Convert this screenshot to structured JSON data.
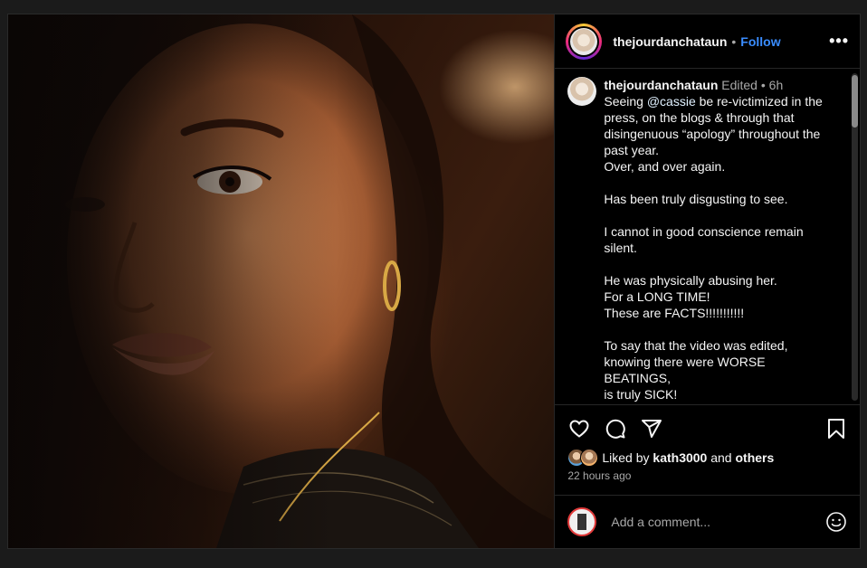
{
  "post": {
    "username": "thejourdanchataun",
    "follow_label": "Follow",
    "separator": "•",
    "more_label": "•••",
    "photo_alt": "portrait photo"
  },
  "caption": {
    "username": "thejourdanchataun",
    "edited": "Edited",
    "dot": "•",
    "time": "6h",
    "lead": "Seeing ",
    "mention": "@cassie",
    "text": " be re-victimized in the press, on the blogs & through that disingenuous “apology” throughout the past year.\nOver, and over again.\n\nHas been truly disgusting to see.\n\nI cannot in good conscience remain silent.\n\nHe was physically abusing her.\nFor a LONG TIME!\nThese are FACTS!!!!!!!!!!!\n\nTo say that the video was edited, knowing there were WORSE BEATINGS,\nis truly SICK!"
  },
  "actions": {
    "like_icon": "heart-icon",
    "comment_icon": "comment-icon",
    "share_icon": "share-icon",
    "save_icon": "bookmark-icon"
  },
  "likes": {
    "prefix": "Liked by",
    "user": "kath3000",
    "and": "and",
    "others": "others"
  },
  "timestamp": "22 hours ago",
  "comment": {
    "placeholder": "Add a comment...",
    "emoji_icon": "emoji-icon"
  },
  "colors": {
    "background": "#000000",
    "link": "#3a8dff",
    "muted": "#a8a8a8"
  }
}
